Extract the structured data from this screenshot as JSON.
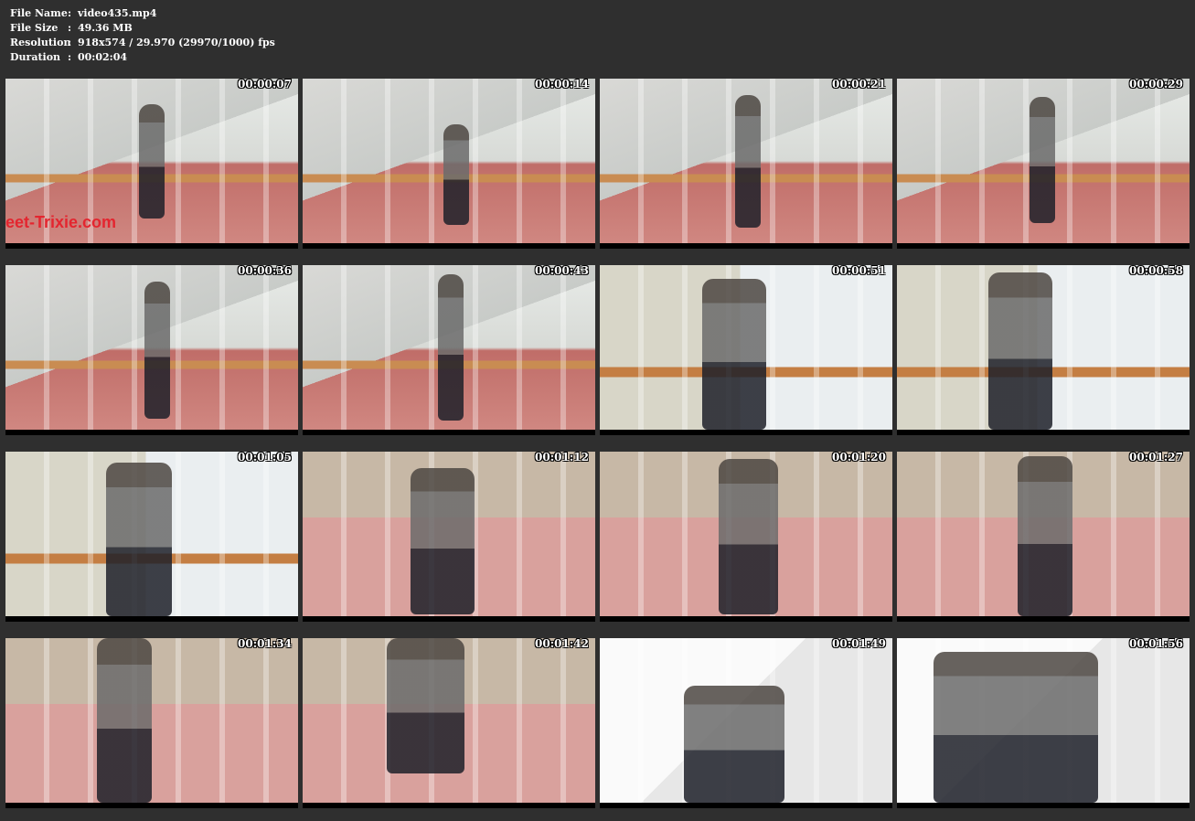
{
  "info": {
    "rows": [
      {
        "key": "File Name",
        "sep": ":",
        "value": "video435.mp4"
      },
      {
        "key": "File Size",
        "sep": ":",
        "value": "49.36 MB"
      },
      {
        "key": "Resolution",
        "sep": ":",
        "value": "918x574 / 29.970 (29970/1000) fps"
      },
      {
        "key": "Duration",
        "sep": ":",
        "value": "00:02:04"
      }
    ]
  },
  "thumbnails": [
    {
      "time": "00:00:07",
      "watermark": "eet-Trixie.com"
    },
    {
      "time": "00:00:14"
    },
    {
      "time": "00:00:21"
    },
    {
      "time": "00:00:29"
    },
    {
      "time": "00:00:36"
    },
    {
      "time": "00:00:43"
    },
    {
      "time": "00:00:51"
    },
    {
      "time": "00:00:58"
    },
    {
      "time": "00:01:05"
    },
    {
      "time": "00:01:12"
    },
    {
      "time": "00:01:20"
    },
    {
      "time": "00:01:27"
    },
    {
      "time": "00:01:34"
    },
    {
      "time": "00:01:42"
    },
    {
      "time": "00:01:49"
    },
    {
      "time": "00:01:56"
    }
  ]
}
